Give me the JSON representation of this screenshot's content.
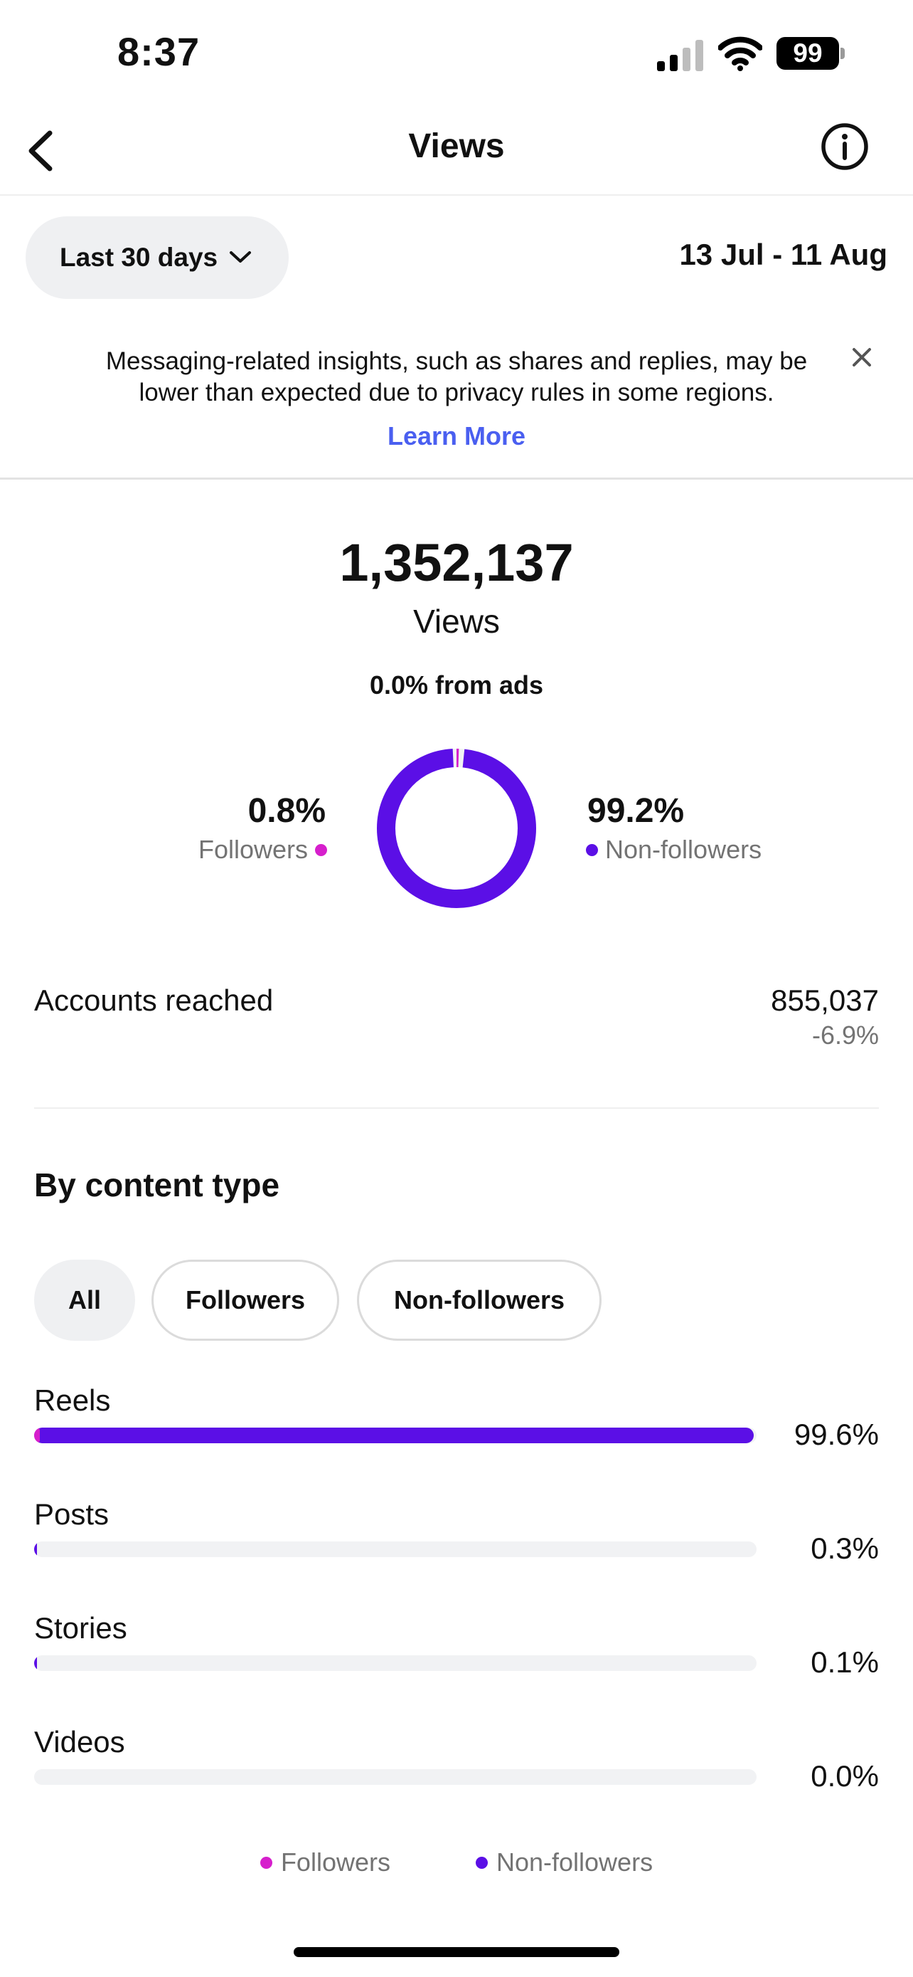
{
  "status_bar": {
    "time": "8:37",
    "battery": "99"
  },
  "nav": {
    "title": "Views",
    "back_icon": "chevron-left-icon",
    "info_icon": "info-icon"
  },
  "filter": {
    "range_label": "Last 30 days",
    "date_range": "13 Jul - 11 Aug"
  },
  "notice": {
    "text": "Messaging-related insights, such as shares and replies, may be lower than expected due to privacy rules in some regions.",
    "link": "Learn More"
  },
  "summary": {
    "total": "1,352,137",
    "label": "Views",
    "ads": "0.0% from ads",
    "followers_pct_text": "0.8%",
    "followers_label": "Followers",
    "nonfollowers_pct_text": "99.2%",
    "nonfollowers_label": "Non-followers",
    "followers_share": 0.8,
    "nonfollowers_share": 99.2
  },
  "reach": {
    "label": "Accounts reached",
    "value": "855,037",
    "change": "-6.9%"
  },
  "content_type": {
    "title": "By content type",
    "chips": [
      "All",
      "Followers",
      "Non-followers"
    ],
    "selected_chip": "All",
    "rows": [
      {
        "label": "Reels",
        "pct_text": "99.6%",
        "pct": 99.6,
        "followers_pct": 0.8
      },
      {
        "label": "Posts",
        "pct_text": "0.3%",
        "pct": 0.3,
        "followers_pct": 0
      },
      {
        "label": "Stories",
        "pct_text": "0.1%",
        "pct": 0.1,
        "followers_pct": 0
      },
      {
        "label": "Videos",
        "pct_text": "0.0%",
        "pct": 0.0,
        "followers_pct": 0
      }
    ]
  },
  "legend": {
    "followers": "Followers",
    "nonfollowers": "Non-followers"
  },
  "colors": {
    "followers": "#d61fcc",
    "nonfollowers": "#5b0fe6",
    "link": "#4a5ff0",
    "track": "#f1f2f4"
  }
}
